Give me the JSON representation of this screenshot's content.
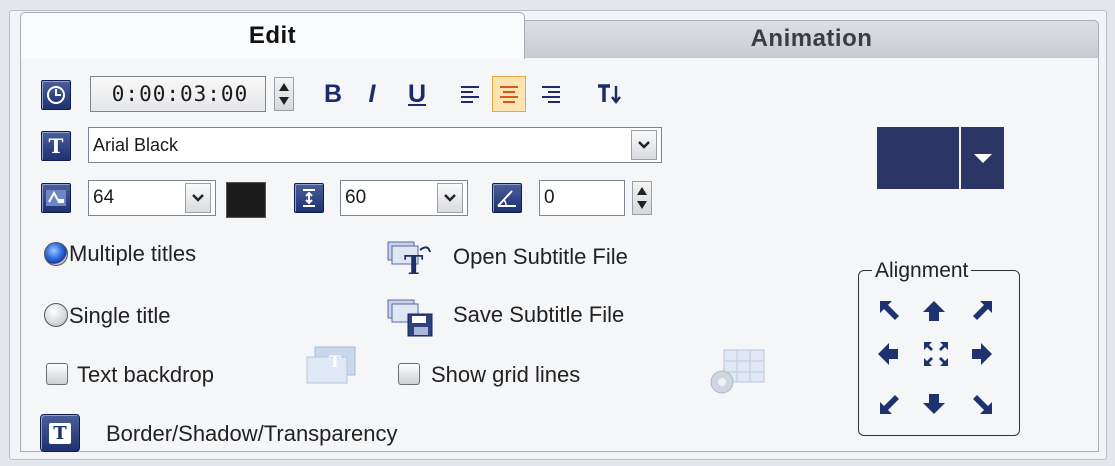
{
  "tabs": [
    {
      "label": "Edit",
      "active": true
    },
    {
      "label": "Animation",
      "active": false
    }
  ],
  "duration": {
    "value": "0:00:03:00",
    "icon": "clock-icon"
  },
  "format_buttons": [
    {
      "label": "B",
      "name": "bold"
    },
    {
      "label": "I",
      "name": "italic"
    },
    {
      "label": "U",
      "name": "underline"
    }
  ],
  "font": {
    "value": "Arial Black"
  },
  "font_size": {
    "value": "64"
  },
  "font_color": "#1c1c1c",
  "line_spacing": {
    "value": "60"
  },
  "angle": {
    "value": "0"
  },
  "options": {
    "multiple_titles": "Multiple titles",
    "single_title": "Single title",
    "text_backdrop": "Text backdrop",
    "show_grid_lines": "Show grid lines",
    "open_subtitle": "Open Subtitle File",
    "save_subtitle": "Save Subtitle File",
    "border_shadow": "Border/Shadow/Transparency",
    "selected_title_mode": "multiple"
  },
  "alignment": {
    "title": "Alignment"
  },
  "colors": {
    "accent": "#2b3665",
    "selected_align": "#fbe3b2"
  }
}
